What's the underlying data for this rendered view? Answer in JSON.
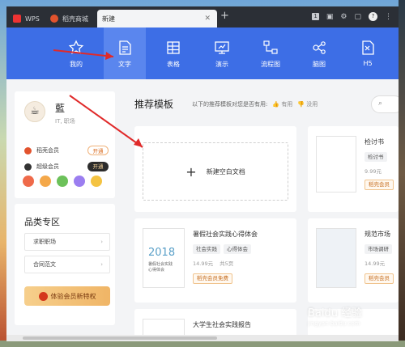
{
  "tabs": [
    {
      "label": "WPS"
    },
    {
      "label": "稻壳商城"
    },
    {
      "label": "新建"
    }
  ],
  "toolbar": {
    "badge_num": "1"
  },
  "categories": [
    {
      "label": "我的",
      "icon": "star-icon"
    },
    {
      "label": "文字",
      "icon": "document-icon",
      "active": true
    },
    {
      "label": "表格",
      "icon": "table-icon"
    },
    {
      "label": "演示",
      "icon": "presentation-icon"
    },
    {
      "label": "流程图",
      "icon": "flowchart-icon"
    },
    {
      "label": "脑图",
      "icon": "mindmap-icon"
    },
    {
      "label": "H5",
      "icon": "h5-icon"
    }
  ],
  "user": {
    "name": "藍",
    "sub": "IT, 职场",
    "rows": [
      {
        "label": "稻壳会员",
        "button": "开通"
      },
      {
        "label": "超级会员",
        "button": "开通"
      }
    ]
  },
  "zone": {
    "title": "品类专区",
    "items": [
      "求职职场",
      "合同范文"
    ],
    "vip_button": "体验会员新特权"
  },
  "main": {
    "title": "推荐模板",
    "question": "以下的推荐模板对您是否有用:",
    "useful": "有用",
    "useless": "没用",
    "new_blank": "新建空白文档"
  },
  "templates": [
    {
      "name": "暑假社会实践心得体会",
      "tags": [
        "社会实践",
        "心得体会"
      ],
      "price": "14.99元",
      "pages": "共5页",
      "free": "稻壳会员免费",
      "cover_year": "2018",
      "cover_title": "暑假社会实践\n心得体会"
    },
    {
      "name": "检讨书",
      "tags": [
        "检讨书"
      ],
      "price": "9.99元",
      "free": "稻壳会员"
    },
    {
      "name": "规范市场",
      "tags": [
        "市场调研"
      ],
      "price": "14.99元",
      "free": "稻壳会员"
    },
    {
      "name": "大学生社会实践报告"
    }
  ],
  "watermark": {
    "main": "Baidu 经验",
    "sub": "jingyan.baidu.com"
  }
}
